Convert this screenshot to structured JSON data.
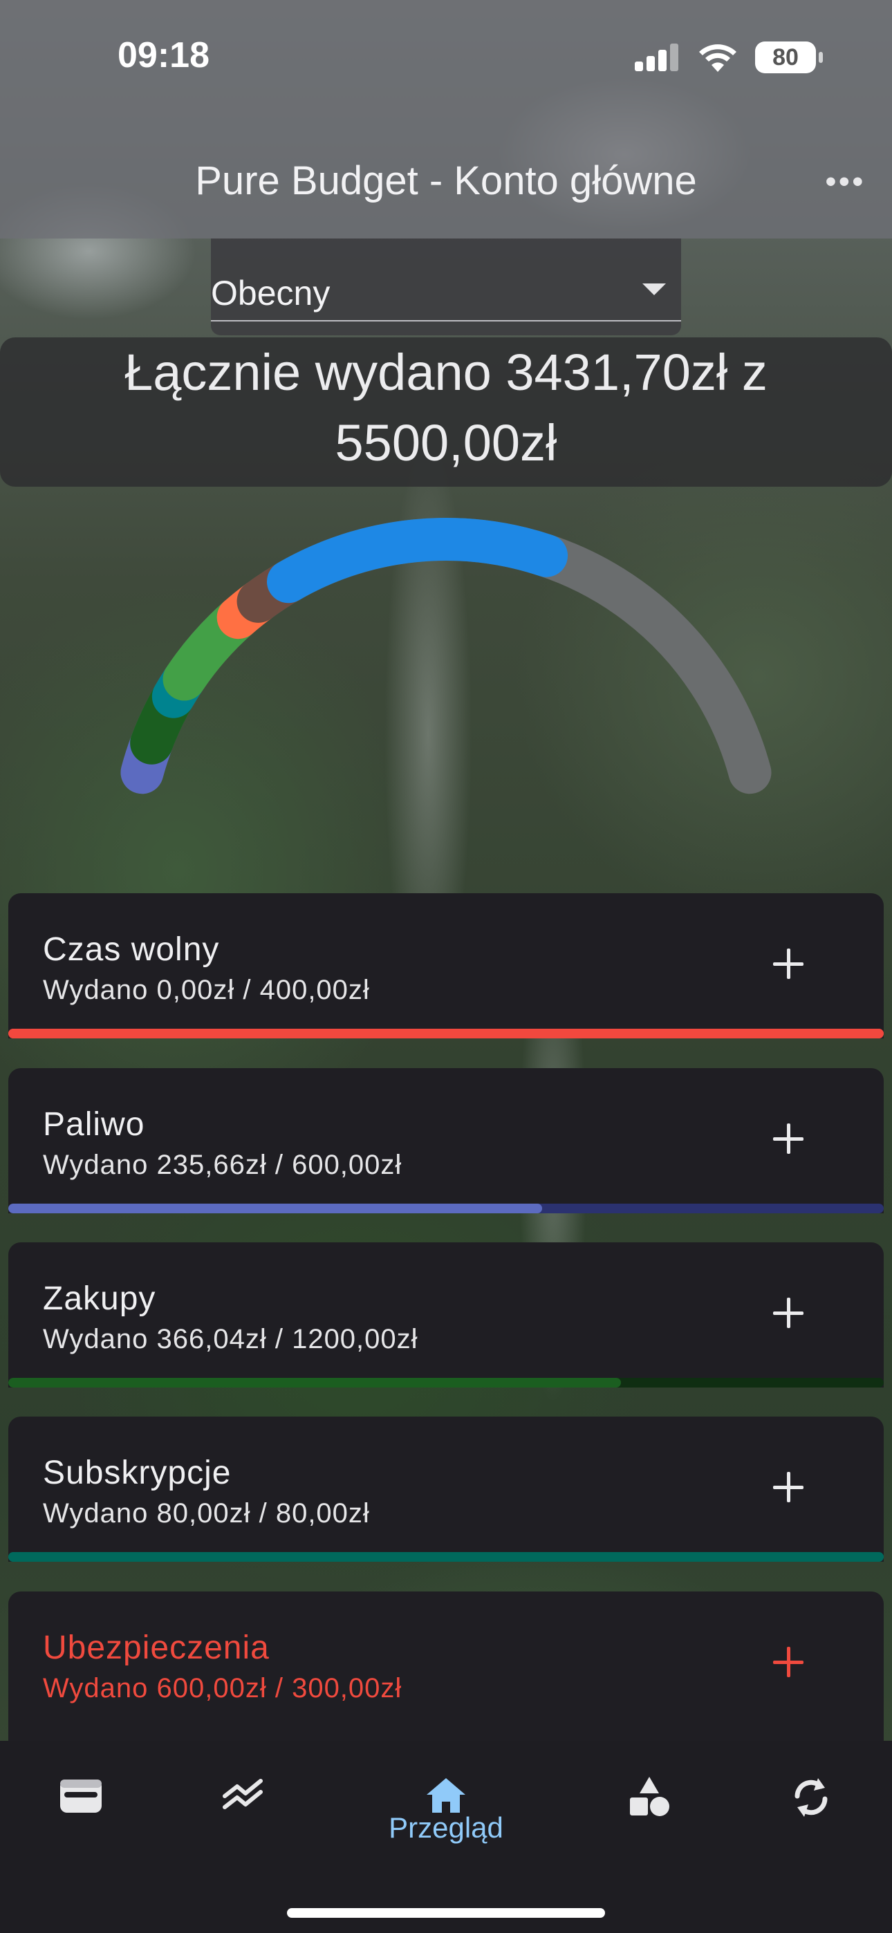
{
  "status_bar": {
    "time": "09:18",
    "battery": "80"
  },
  "header": {
    "title": "Pure Budget - Konto główne",
    "more_icon": "more-horizontal-icon"
  },
  "period_select": {
    "selected": "Obecny"
  },
  "summary": {
    "line1": "Łącznie wydano 3431,70zł z",
    "line2": "5500,00zł"
  },
  "gauge": {
    "spent": 3431.7,
    "total": 5500.0,
    "segments": [
      {
        "color": "#5c6bc0"
      },
      {
        "color": "#1b5e20"
      },
      {
        "color": "#00838f"
      },
      {
        "color": "#43a047"
      },
      {
        "color": "#ff7043"
      },
      {
        "color": "#6d4c41"
      },
      {
        "color": "#1e88e5"
      }
    ],
    "track_color": "#6a6d6e"
  },
  "categories": [
    {
      "name": "Czas wolny",
      "spent_text": "Wydano 0,00zł / 400,00zł",
      "fraction": 1.0,
      "color": "#f2483e",
      "track": "#f2483e",
      "over": false
    },
    {
      "name": "Paliwo",
      "spent_text": "Wydano 235,66zł / 600,00zł",
      "fraction": 0.61,
      "color": "#5c6bc0",
      "track": "#2b3270",
      "over": false
    },
    {
      "name": "Zakupy",
      "spent_text": "Wydano 366,04zł / 1200,00zł",
      "fraction": 0.7,
      "color": "#1b5e20",
      "track": "#0f2e12",
      "over": false
    },
    {
      "name": "Subskrypcje",
      "spent_text": "Wydano 80,00zł / 80,00zł",
      "fraction": 1.0,
      "color": "#00695c",
      "track": "#00695c",
      "over": false
    },
    {
      "name": "Ubezpieczenia",
      "spent_text": "Wydano 600,00zł / 300,00zł",
      "fraction": 1.0,
      "color": "#3b5a3b",
      "track": "#3b5a3b",
      "over": true
    }
  ],
  "nav": {
    "items": [
      {
        "icon": "wallet-icon",
        "label": ""
      },
      {
        "icon": "trend-chart-icon",
        "label": ""
      },
      {
        "icon": "home-icon",
        "label": "Przegląd",
        "active": true
      },
      {
        "icon": "shapes-icon",
        "label": ""
      },
      {
        "icon": "sync-icon",
        "label": ""
      }
    ],
    "active_color": "#90caf9"
  }
}
